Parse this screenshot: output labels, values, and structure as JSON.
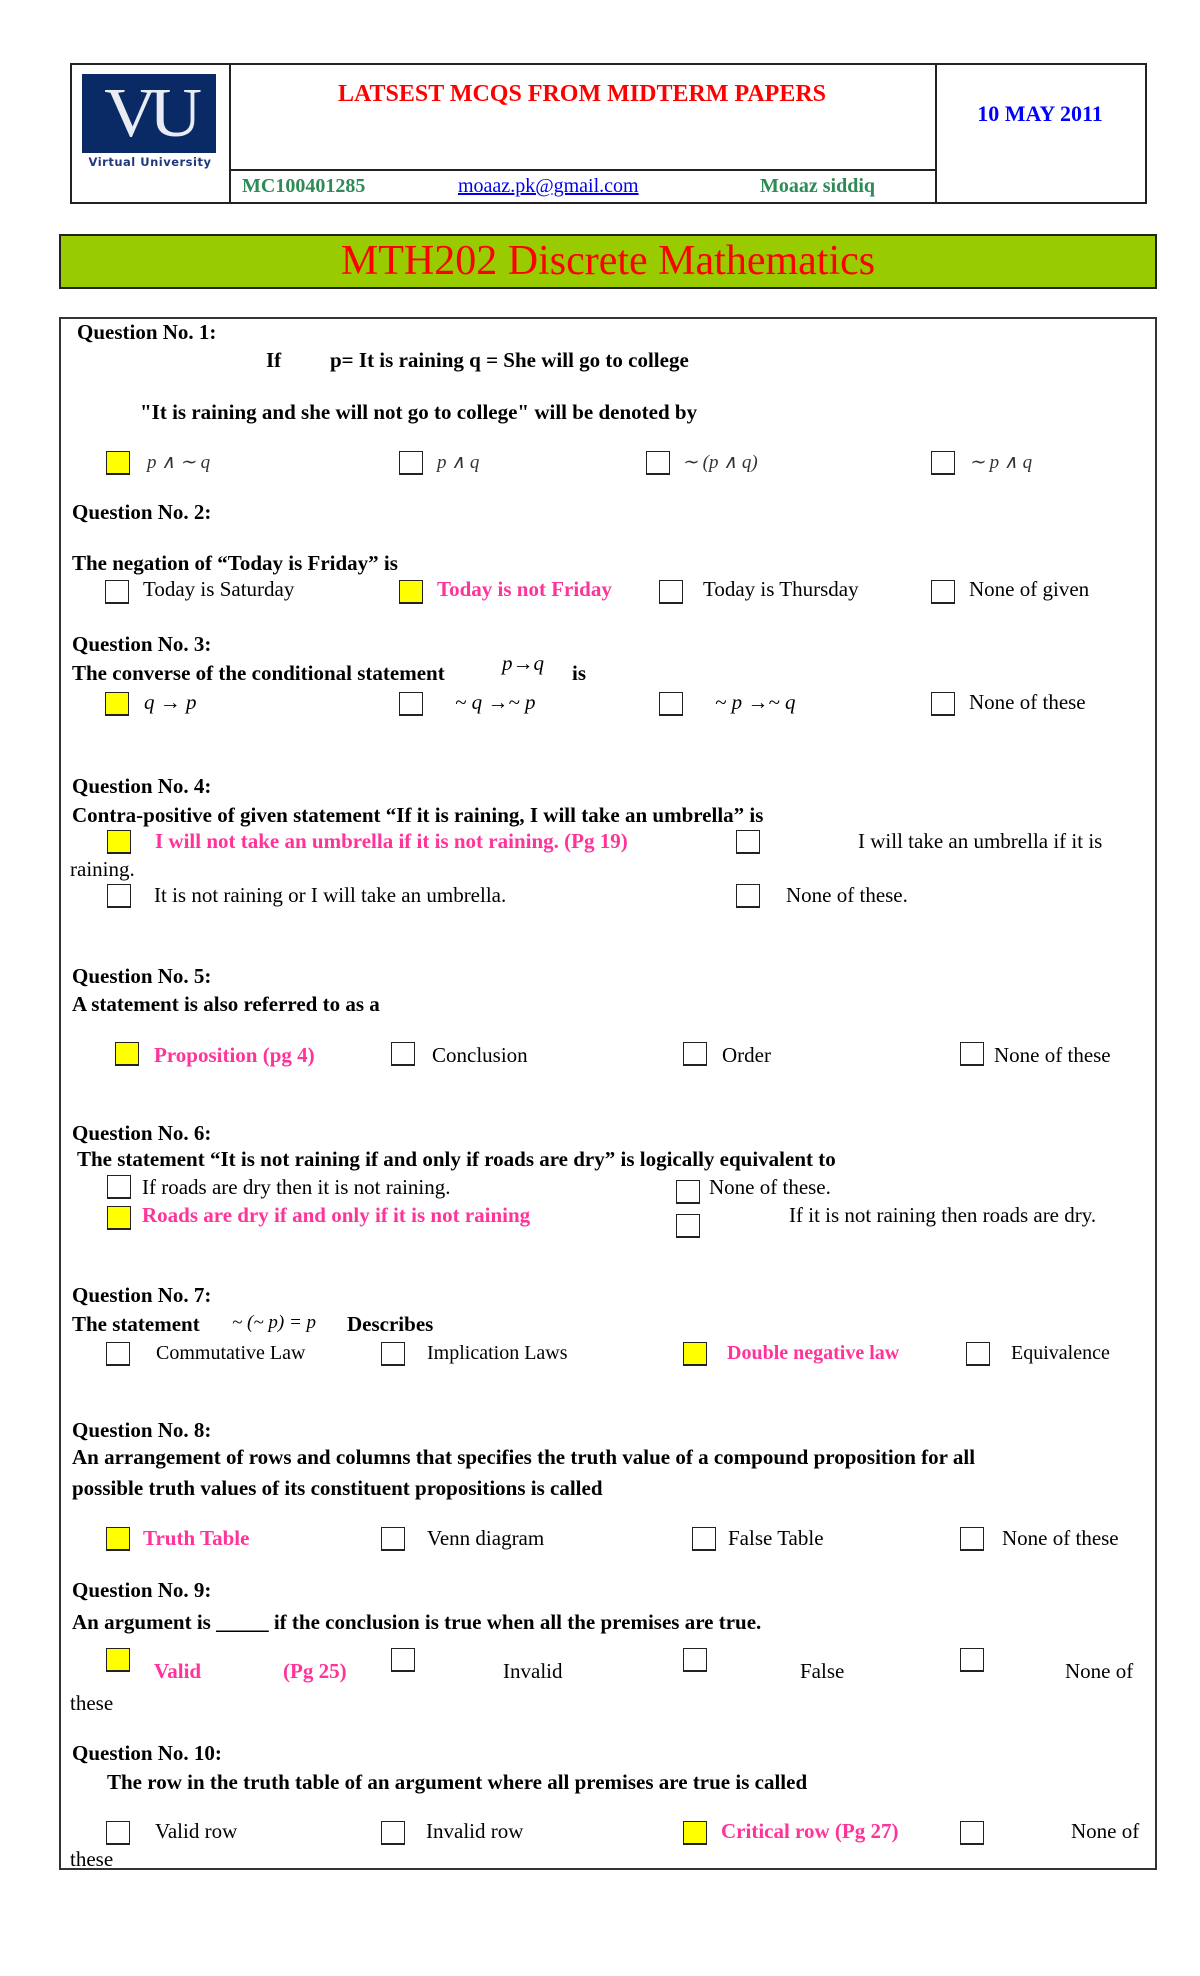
{
  "header": {
    "logo_text": "VU",
    "logo_caption": "Virtual University",
    "title": "LATSEST MCQS FROM MIDTERM  PAPERS",
    "date": "10 MAY 2011",
    "student_id": "MC100401285",
    "email": "moaaz.pk@gmail.com",
    "author": "Moaaz siddiq"
  },
  "banner": {
    "title": "MTH202 Discrete Mathematics"
  },
  "colors": {
    "banner_bg": "#99cc00",
    "title_red": "#ff0000",
    "date_blue": "#0000ff",
    "info_green": "#2e8b57",
    "answer_pink": "#ff3399",
    "selected_box": "#ffff00"
  },
  "questions": [
    {
      "title": "Question No. 1:",
      "lines": [
        "If",
        "p= It is raining   q = She will go to college",
        "\"It is raining and she will not go to college\"   will be denoted by"
      ],
      "options": [
        {
          "label": "p ∧ ∼ q",
          "selected": true
        },
        {
          "label": "p ∧ q",
          "selected": false
        },
        {
          "label": "∼ (p ∧ q)",
          "selected": false
        },
        {
          "label": "∼ p ∧ q",
          "selected": false
        }
      ]
    },
    {
      "title": "Question No. 2:",
      "lines": [
        "The negation of “Today is Friday” is"
      ],
      "options": [
        {
          "label": "Today is Saturday",
          "selected": false
        },
        {
          "label": "Today is not Friday",
          "selected": true
        },
        {
          "label": "Today is Thursday",
          "selected": false
        },
        {
          "label": "None of given",
          "selected": false
        }
      ]
    },
    {
      "title": "Question No. 3:",
      "lines": [
        "The converse of the conditional statement",
        "p→q",
        "is"
      ],
      "options": [
        {
          "label": "q → p",
          "selected": true
        },
        {
          "label": "~ q →~ p",
          "selected": false
        },
        {
          "label": "~ p →~ q",
          "selected": false
        },
        {
          "label": "None of these",
          "selected": false
        }
      ]
    },
    {
      "title": "Question No. 4:",
      "lines": [
        "Contra-positive of given statement “If it is raining, I will take an umbrella” is"
      ],
      "options": [
        {
          "label": "I will not take an umbrella if it is not raining. (Pg 19)",
          "selected": true
        },
        {
          "label": "I will take an umbrella if it is",
          "label_cont": "raining.",
          "selected": false
        },
        {
          "label": "It is not raining or I will take an umbrella.",
          "selected": false
        },
        {
          "label": "None of these.",
          "selected": false
        }
      ]
    },
    {
      "title": "Question No. 5:",
      "lines": [
        "A statement is also referred to as a"
      ],
      "options": [
        {
          "label": "Proposition  (pg 4)",
          "selected": true
        },
        {
          "label": "Conclusion",
          "selected": false
        },
        {
          "label": "Order",
          "selected": false
        },
        {
          "label": "None of these",
          "selected": false
        }
      ]
    },
    {
      "title": "Question No. 6:",
      "lines": [
        "The statement “It is not raining if and only if roads are dry” is logically equivalent to"
      ],
      "options": [
        {
          "label": "If roads are dry then it is not raining.",
          "selected": false
        },
        {
          "label": "None of these.",
          "selected": false
        },
        {
          "label": "Roads are dry if and only if it is not raining",
          "selected": true
        },
        {
          "label": "If it is not raining then roads are dry.",
          "selected": false
        }
      ]
    },
    {
      "title": "Question No. 7:",
      "lines": [
        "The statement",
        "~ (~ p) = p",
        "Describes"
      ],
      "options": [
        {
          "label": "Commutative Law",
          "selected": false
        },
        {
          "label": "Implication Laws",
          "selected": false
        },
        {
          "label": "Double negative law",
          "selected": true
        },
        {
          "label": "Equivalence",
          "selected": false
        }
      ]
    },
    {
      "title": "Question No. 8:",
      "lines": [
        "An arrangement of rows and columns that specifies the truth value of a compound proposition for all",
        "possible truth values of its constituent propositions is called"
      ],
      "options": [
        {
          "label": "Truth Table",
          "selected": true
        },
        {
          "label": "Venn diagram",
          "selected": false
        },
        {
          "label": "False Table",
          "selected": false
        },
        {
          "label": "None of these",
          "selected": false
        }
      ]
    },
    {
      "title": "Question No. 9:",
      "lines": [
        "An argument is _____ if the conclusion is true when all the premises are true."
      ],
      "options": [
        {
          "label": "Valid",
          "note": "(Pg 25)",
          "selected": true
        },
        {
          "label": "Invalid",
          "selected": false
        },
        {
          "label": "False",
          "selected": false
        },
        {
          "label": "None of",
          "label_cont": "these",
          "selected": false
        }
      ]
    },
    {
      "title": "Question No. 10:",
      "lines": [
        "The row in the truth table of an argument where all premises are true is called"
      ],
      "options": [
        {
          "label": "Valid row",
          "selected": false
        },
        {
          "label": "Invalid row",
          "selected": false
        },
        {
          "label": "Critical row (Pg 27)",
          "selected": true
        },
        {
          "label": "None of",
          "label_cont": "these",
          "selected": false
        }
      ]
    }
  ]
}
